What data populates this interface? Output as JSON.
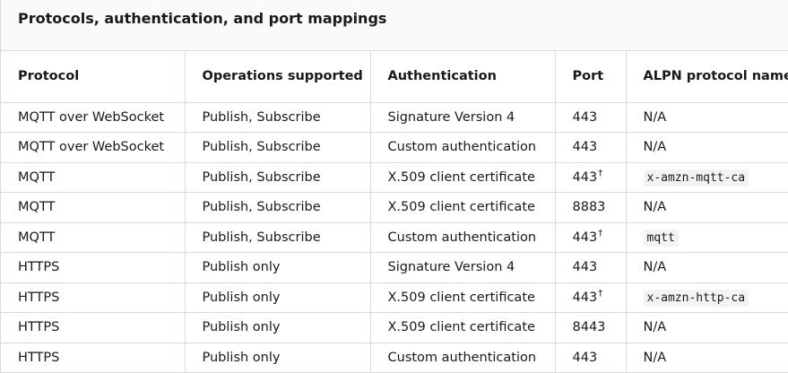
{
  "title": "Protocols, authentication, and port mappings",
  "columns": [
    "Protocol",
    "Operations supported",
    "Authentication",
    "Port",
    "ALPN protocol name"
  ],
  "rows": [
    {
      "protocol": "MQTT over WebSocket",
      "operations": "Publish, Subscribe",
      "authentication": "Signature Version 4",
      "port": "443",
      "port_note": "",
      "alpn": "N/A",
      "alpn_code": false
    },
    {
      "protocol": "MQTT over WebSocket",
      "operations": "Publish, Subscribe",
      "authentication": "Custom authentication",
      "port": "443",
      "port_note": "",
      "alpn": "N/A",
      "alpn_code": false
    },
    {
      "protocol": "MQTT",
      "operations": "Publish, Subscribe",
      "authentication": "X.509 client certificate",
      "port": "443",
      "port_note": "†",
      "alpn": "x-amzn-mqtt-ca",
      "alpn_code": true
    },
    {
      "protocol": "MQTT",
      "operations": "Publish, Subscribe",
      "authentication": "X.509 client certificate",
      "port": "8883",
      "port_note": "",
      "alpn": "N/A",
      "alpn_code": false
    },
    {
      "protocol": "MQTT",
      "operations": "Publish, Subscribe",
      "authentication": "Custom authentication",
      "port": "443",
      "port_note": "†",
      "alpn": "mqtt",
      "alpn_code": true
    },
    {
      "protocol": "HTTPS",
      "operations": "Publish only",
      "authentication": "Signature Version 4",
      "port": "443",
      "port_note": "",
      "alpn": "N/A",
      "alpn_code": false
    },
    {
      "protocol": "HTTPS",
      "operations": "Publish only",
      "authentication": "X.509 client certificate",
      "port": "443",
      "port_note": "†",
      "alpn": "x-amzn-http-ca",
      "alpn_code": true
    },
    {
      "protocol": "HTTPS",
      "operations": "Publish only",
      "authentication": "X.509 client certificate",
      "port": "8443",
      "port_note": "",
      "alpn": "N/A",
      "alpn_code": false
    },
    {
      "protocol": "HTTPS",
      "operations": "Publish only",
      "authentication": "Custom authentication",
      "port": "443",
      "port_note": "",
      "alpn": "N/A",
      "alpn_code": false
    }
  ]
}
